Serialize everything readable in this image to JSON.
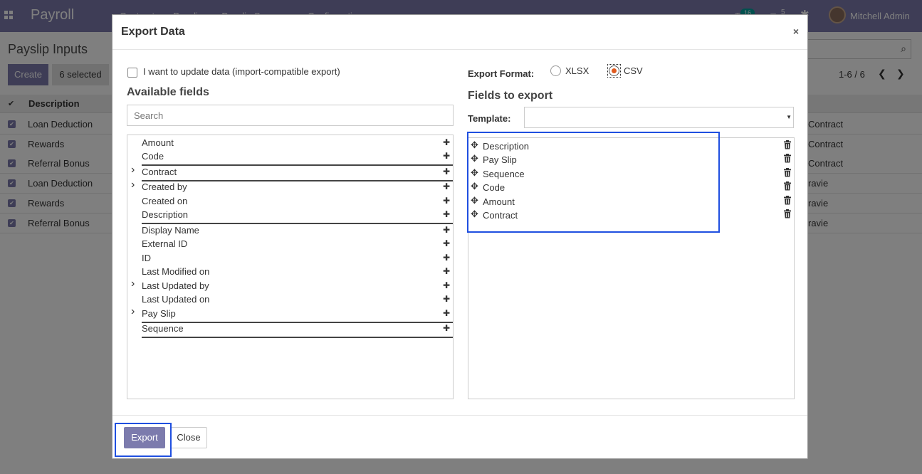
{
  "app": {
    "brand": "Payroll",
    "menu": [
      "Contracts",
      "Payslips",
      "Payslip Summary",
      "Configuration"
    ],
    "activity_count": "16",
    "message_count": "5",
    "user": "Mitchell Admin"
  },
  "page": {
    "title": "Payslip Inputs",
    "create_label": "Create",
    "selected_label": "6 selected",
    "pager": "1-6 / 6",
    "column_description": "Description",
    "rows": [
      {
        "description": "Loan Deduction",
        "right": "Contract"
      },
      {
        "description": "Rewards",
        "right": "Contract"
      },
      {
        "description": "Referral Bonus",
        "right": "Contract"
      },
      {
        "description": "Loan Deduction",
        "right": "ravie"
      },
      {
        "description": "Rewards",
        "right": "ravie"
      },
      {
        "description": "Referral Bonus",
        "right": "ravie"
      }
    ]
  },
  "dialog": {
    "title": "Export Data",
    "close_symbol": "×",
    "import_compatible_label": "I want to update data (import-compatible export)",
    "available_title": "Available fields",
    "search_placeholder": "Search",
    "available_fields": [
      {
        "label": "Amount",
        "expandable": false,
        "separator": false
      },
      {
        "label": "Code",
        "expandable": false,
        "separator": true
      },
      {
        "label": "Contract",
        "expandable": true,
        "separator": true
      },
      {
        "label": "Created by",
        "expandable": true,
        "separator": false
      },
      {
        "label": "Created on",
        "expandable": false,
        "separator": false
      },
      {
        "label": "Description",
        "expandable": false,
        "separator": true
      },
      {
        "label": "Display Name",
        "expandable": false,
        "separator": false
      },
      {
        "label": "External ID",
        "expandable": false,
        "separator": false
      },
      {
        "label": "ID",
        "expandable": false,
        "separator": false
      },
      {
        "label": "Last Modified on",
        "expandable": false,
        "separator": false
      },
      {
        "label": "Last Updated by",
        "expandable": true,
        "separator": false
      },
      {
        "label": "Last Updated on",
        "expandable": false,
        "separator": false
      },
      {
        "label": "Pay Slip",
        "expandable": true,
        "separator": true
      },
      {
        "label": "Sequence",
        "expandable": false,
        "separator": true
      }
    ],
    "export_format_label": "Export Format:",
    "formats": [
      {
        "label": "XLSX",
        "checked": false
      },
      {
        "label": "CSV",
        "checked": true
      }
    ],
    "fields_to_export_title": "Fields to export",
    "template_label": "Template:",
    "template_value": "",
    "export_fields": [
      "Description",
      "Pay Slip",
      "Sequence",
      "Code",
      "Amount",
      "Contract"
    ],
    "export_button": "Export",
    "close_button": "Close"
  },
  "colors": {
    "brand": "#7c7bad",
    "radio_checked": "#e05a1f",
    "highlight": "#1f4fe0",
    "badge": "#00a09d"
  }
}
